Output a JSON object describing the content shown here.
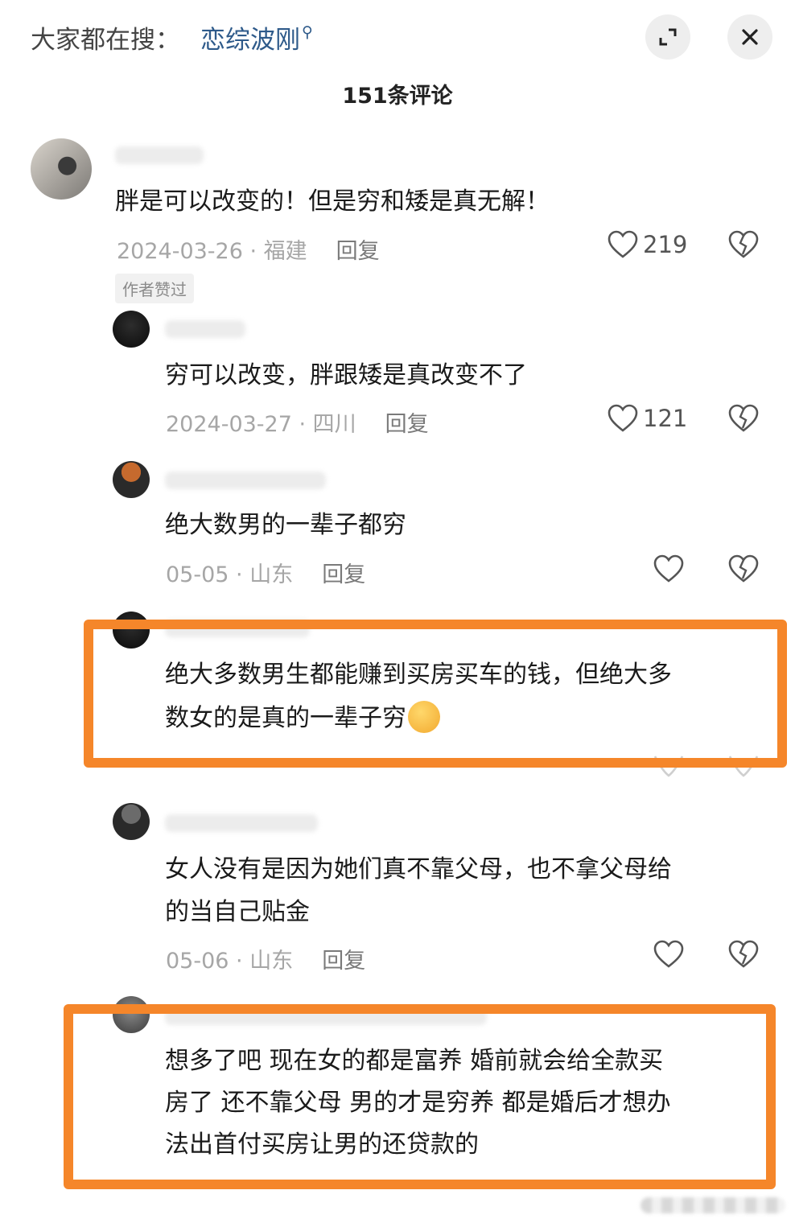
{
  "header": {
    "search_label": "大家都在搜：",
    "search_term": "恋综波刚",
    "search_icon": "magnifier-icon",
    "expand_icon": "expand-icon",
    "close_icon": "close-icon"
  },
  "comment_count_title": "151条评论",
  "comments": [
    {
      "text_lines": [
        "胖是可以改变的！但是穷和矮是真无解！"
      ],
      "date": "2024-03-26",
      "location": "福建",
      "reply_label": "回复",
      "likes": "219",
      "badge": "作者赞过"
    },
    {
      "text_lines": [
        "穷可以改变，胖跟矮是真改变不了"
      ],
      "date": "2024-03-27",
      "location": "四川",
      "reply_label": "回复",
      "likes": "121"
    },
    {
      "text_lines": [
        "绝大数男的一辈子都穷"
      ],
      "date": "05-05",
      "location": "山东",
      "reply_label": "回复",
      "likes": ""
    },
    {
      "text_lines": [
        "绝大多数男生都能赚到买房买车的钱，但绝大多",
        "数女的是真的一辈子穷"
      ],
      "emoji_icon": "smirk-emoji-icon",
      "highlighted": true,
      "highlight_color": "#f5862a"
    },
    {
      "text_lines": [
        "女人没有是因为她们真不靠父母，也不拿父母给",
        "的当自己贴金"
      ],
      "date": "05-06",
      "location": "山东",
      "reply_label": "回复",
      "likes": ""
    },
    {
      "text_lines": [
        "想多了吧 现在女的都是富养 婚前就会给全款买",
        "房了 还不靠父母 男的才是穷养 都是婚后才想办",
        "法出首付买房让男的还贷款的"
      ],
      "highlighted": true,
      "highlight_color": "#f5862a"
    }
  ]
}
